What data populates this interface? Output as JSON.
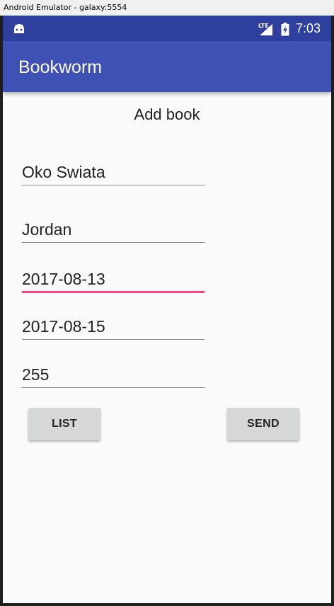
{
  "window": {
    "title": "Android Emulator - galaxy:5554"
  },
  "status_bar": {
    "time": "7:03",
    "network_label": "LTE",
    "icons": [
      "android-notification-icon",
      "lte-signal-icon",
      "battery-charging-icon"
    ]
  },
  "app_bar": {
    "title": "Bookworm",
    "color": "#3f51b5"
  },
  "page": {
    "heading": "Add book"
  },
  "form": {
    "fields": [
      {
        "value": "Oko Swiata",
        "focused": false
      },
      {
        "value": "Jordan",
        "focused": false
      },
      {
        "value": "2017-08-13",
        "focused": true
      },
      {
        "value": "2017-08-15",
        "focused": false
      },
      {
        "value": "255",
        "focused": false
      }
    ],
    "accent_color": "#ff4081"
  },
  "buttons": {
    "list_label": "LIST",
    "send_label": "SEND"
  }
}
